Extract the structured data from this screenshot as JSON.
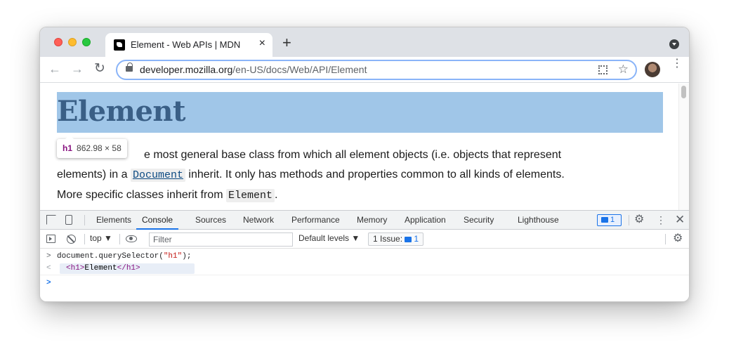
{
  "browser": {
    "tab": {
      "title": "Element - Web APIs | MDN",
      "close_icon": "×",
      "new_tab_icon": "+"
    },
    "address": {
      "host": "developer.mozilla.org",
      "path": "/en-US/docs/Web/API/Element"
    },
    "icons": {
      "back": "←",
      "forward": "→",
      "reload": "↻",
      "star": "☆",
      "menu": "⋮"
    }
  },
  "page": {
    "heading": "Element",
    "paragraph": {
      "line1": "e most general base class from which all element objects (i.e. objects that represent",
      "line2_pre": "elements) in a ",
      "line2_link": "Document",
      "line2_post": " inherit. It only has methods and properties common to all kinds of elements.",
      "line3_pre": "More specific classes inherit from ",
      "line3_code": "Element",
      "line3_post": "."
    },
    "inspect_tooltip": {
      "tag": "h1",
      "size": "862.98 × 58"
    }
  },
  "devtools": {
    "tabs": [
      "Elements",
      "Console",
      "Sources",
      "Network",
      "Performance",
      "Memory",
      "Application",
      "Security",
      "Lighthouse"
    ],
    "active_tab": "Console",
    "message_badge_count": "1",
    "console_bar": {
      "context": "top ▼",
      "filter_placeholder": "Filter",
      "levels": "Default levels ▼",
      "issues_label": "1 Issue:",
      "issues_count": "1"
    },
    "console": {
      "input_prompt": ">",
      "input_code_pre": "document.querySelector(",
      "input_code_str": "\"h1\"",
      "input_code_post": ");",
      "result_prompt": "<",
      "result_open": "<h1>",
      "result_text": "Element",
      "result_close": "</h1>",
      "active_prompt": ">"
    }
  },
  "colors": {
    "highlight": "#6fa8dc",
    "accent": "#1a73e8",
    "tag": "#881280",
    "string": "#c41a16"
  }
}
